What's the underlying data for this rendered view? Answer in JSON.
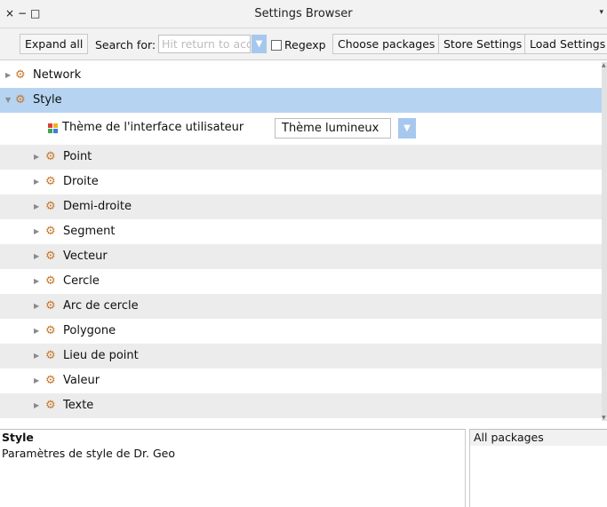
{
  "window": {
    "title": "Settings Browser",
    "close_glyph": "×",
    "minimize_glyph": "−",
    "maximize_glyph": "□",
    "menu_glyph": "▾"
  },
  "toolbar": {
    "expand_all": "Expand all",
    "search_label": "Search for:",
    "search_placeholder": "Hit return to acc",
    "regexp_label": "Regexp",
    "choose_packages": "Choose packages",
    "store_settings": "Store Settings",
    "load_settings": "Load Settings"
  },
  "tree": {
    "network": "Network",
    "style": "Style",
    "theme_label": "Thème de l'interface utilisateur",
    "theme_value": "Thème lumineux",
    "children": [
      "Point",
      "Droite",
      "Demi-droite",
      "Segment",
      "Vecteur",
      "Cercle",
      "Arc de cercle",
      "Polygone",
      "Lieu de point",
      "Valeur",
      "Texte"
    ]
  },
  "description": {
    "title": "Style",
    "text": "Paramètres de style de Dr. Geo"
  },
  "packages": {
    "items": [
      "All packages"
    ]
  },
  "colors": {
    "selection": "#b6d4f2",
    "dropdown_accent": "#a6c8ee",
    "setting_icon": "#c9762a",
    "alt_row": "#ececec"
  },
  "icons": {
    "setting": "settings-wrench-icon",
    "expand": "triangle-right-icon",
    "collapse": "triangle-down-icon",
    "theme": "colored-grid-icon"
  }
}
